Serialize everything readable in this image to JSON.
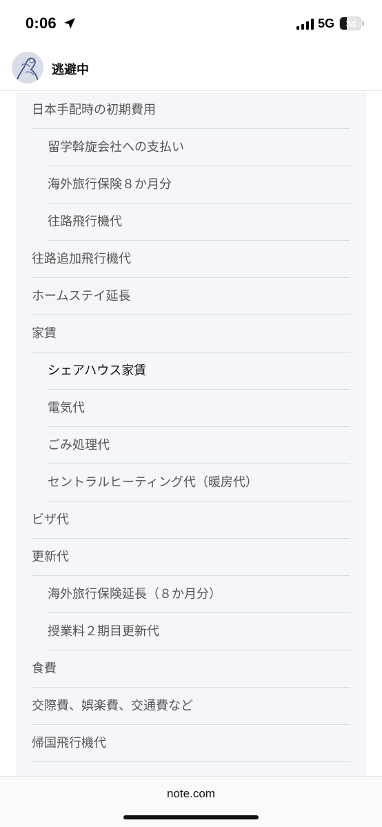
{
  "status_bar": {
    "time": "0:06",
    "network": "5G",
    "battery_level": "34",
    "icons": [
      "location-arrow-icon",
      "cellular-signal-icon",
      "battery-icon"
    ]
  },
  "header": {
    "channel_name": "逃避中"
  },
  "toc": {
    "items": [
      {
        "label": "日本手配時の初期費用",
        "level": 1
      },
      {
        "label": "留学斡旋会社への支払い",
        "level": 2
      },
      {
        "label": "海外旅行保険８か月分",
        "level": 2
      },
      {
        "label": "往路飛行機代",
        "level": 2
      },
      {
        "label": "往路追加飛行機代",
        "level": 1
      },
      {
        "label": "ホームステイ延長",
        "level": 1
      },
      {
        "label": "家賃",
        "level": 1
      },
      {
        "label": "シェアハウス家賃",
        "level": 2,
        "active": true
      },
      {
        "label": "電気代",
        "level": 2
      },
      {
        "label": "ごみ処理代",
        "level": 2
      },
      {
        "label": "セントラルヒーティング代（暖房代）",
        "level": 2
      },
      {
        "label": "ビザ代",
        "level": 1
      },
      {
        "label": "更新代",
        "level": 1
      },
      {
        "label": "海外旅行保険延長（８か月分）",
        "level": 2
      },
      {
        "label": "授業料２期目更新代",
        "level": 2
      },
      {
        "label": "食費",
        "level": 1
      },
      {
        "label": "交際費、娯楽費、交通費など",
        "level": 1
      },
      {
        "label": "帰国飛行機代",
        "level": 1
      }
    ]
  },
  "browser": {
    "domain": "note.com"
  },
  "colors": {
    "toc_background": "#f4f6f9",
    "toc_text": "#555555",
    "toc_text_active": "#111111",
    "divider": "#d9dce0"
  }
}
